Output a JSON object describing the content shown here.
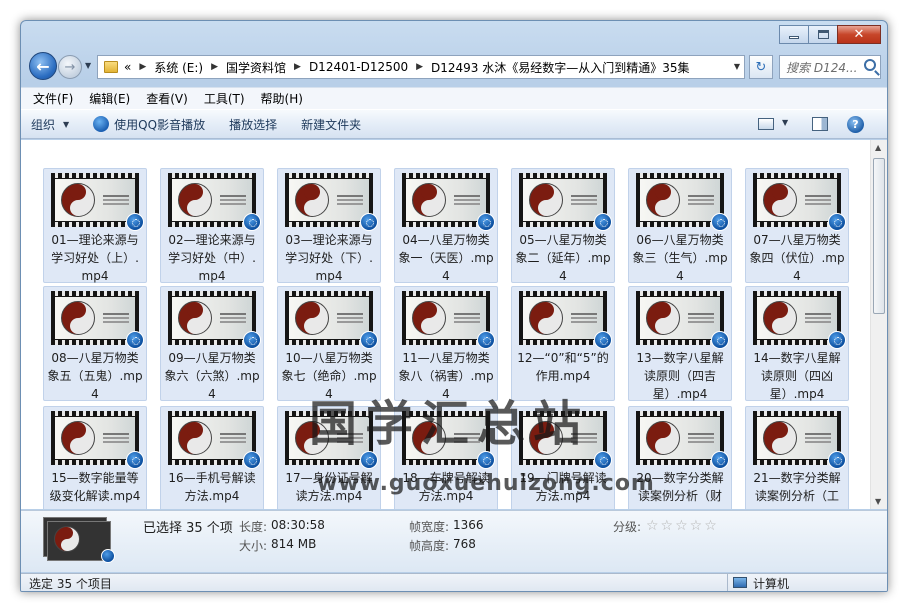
{
  "window": {
    "minimize_glyph": "—",
    "maximize_glyph": "□",
    "close_glyph": "✕"
  },
  "nav": {
    "back_glyph": "←",
    "forward_glyph": "→",
    "dropdown_glyph": "▼",
    "address": {
      "prefix": "«",
      "crumbs": [
        "系统 (E:)",
        "国学资料馆",
        "D12401-D12500",
        "D12493 水沐《易经数字—从入门到精通》35集"
      ],
      "separator": "▶"
    },
    "refresh_glyph": "↻",
    "search_placeholder": "搜索 D124..."
  },
  "menu": [
    "文件(F)",
    "编辑(E)",
    "查看(V)",
    "工具(T)",
    "帮助(H)"
  ],
  "commands": {
    "organize": "组织",
    "play_qq": "使用QQ影音播放",
    "play_selection": "播放选择",
    "new_folder": "新建文件夹",
    "help_glyph": "?"
  },
  "files": [
    "01—理论来源与学习好处（上）.mp4",
    "02—理论来源与学习好处（中）.mp4",
    "03—理论来源与学习好处（下）.mp4",
    "04—八星万物类象一（天医）.mp4",
    "05—八星万物类象二（延年）.mp4",
    "06—八星万物类象三（生气）.mp4",
    "07—八星万物类象四（伏位）.mp4",
    "08—八星万物类象五（五鬼）.mp4",
    "09—八星万物类象六（六煞）.mp4",
    "10—八星万物类象七（绝命）.mp4",
    "11—八星万物类象八（祸害）.mp4",
    "12—“0”和“5”的作用.mp4",
    "13—数字八星解读原则（四吉星）.mp4",
    "14—数字八星解读原则（四凶星）.mp4",
    "15—数字能量等级变化解读.mp4",
    "16—手机号解读方法.mp4",
    "17—身份证号解读方法.mp4",
    "18—车牌号解读方法.mp4",
    "19—门牌号解读方法.mp4",
    "20—数字分类解读案例分析（财",
    "21—数字分类解读案例分析（工"
  ],
  "watermark": {
    "title": "国学汇总站",
    "url": "www.guoxuehuizong.com"
  },
  "details": {
    "selected": "已选择 35 个项",
    "length_label": "长度:",
    "length_value": "08:30:58",
    "size_label": "大小:",
    "size_value": "814 MB",
    "frame_width_label": "帧宽度:",
    "frame_width_value": "1366",
    "frame_height_label": "帧高度:",
    "frame_height_value": "768",
    "rating_label": "分级:",
    "rating_stars": "☆☆☆☆☆",
    "rating_value": 0
  },
  "status": {
    "left": "选定 35 个项目",
    "right": "计算机"
  },
  "scroll": {
    "up_glyph": "▲",
    "down_glyph": "▼"
  }
}
